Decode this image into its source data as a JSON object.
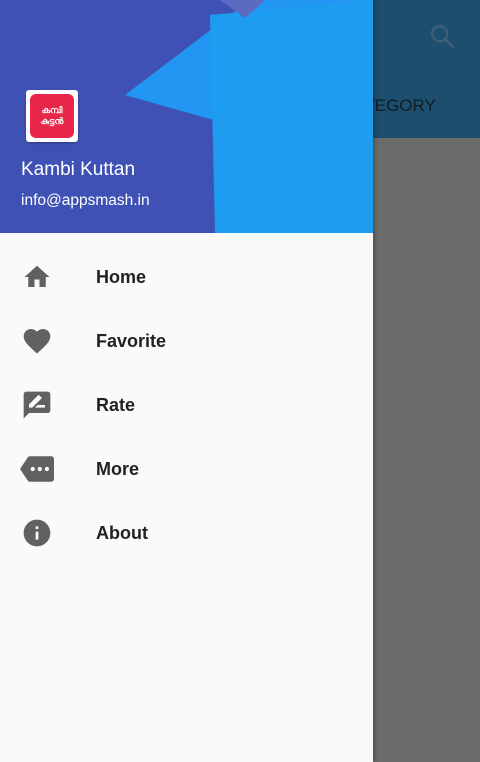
{
  "app": {
    "tab_label": "CATEGORY"
  },
  "drawer": {
    "logo_text": "കമ്പി കുട്ടൻ",
    "user_name": "Kambi Kuttan",
    "user_email": "info@appsmash.in",
    "items": [
      {
        "label": "Home",
        "icon": "home-icon"
      },
      {
        "label": "Favorite",
        "icon": "heart-icon"
      },
      {
        "label": "Rate",
        "icon": "rate-review-icon"
      },
      {
        "label": "More",
        "icon": "more-tag-icon"
      },
      {
        "label": "About",
        "icon": "info-icon"
      }
    ]
  },
  "colors": {
    "header_primary": "#3f51b5",
    "header_accent": "#03a9f4",
    "toolbar": "#1d4e6d",
    "scrim": "#6b6b6b",
    "icon": "#616161",
    "logo": "#e8264a"
  }
}
